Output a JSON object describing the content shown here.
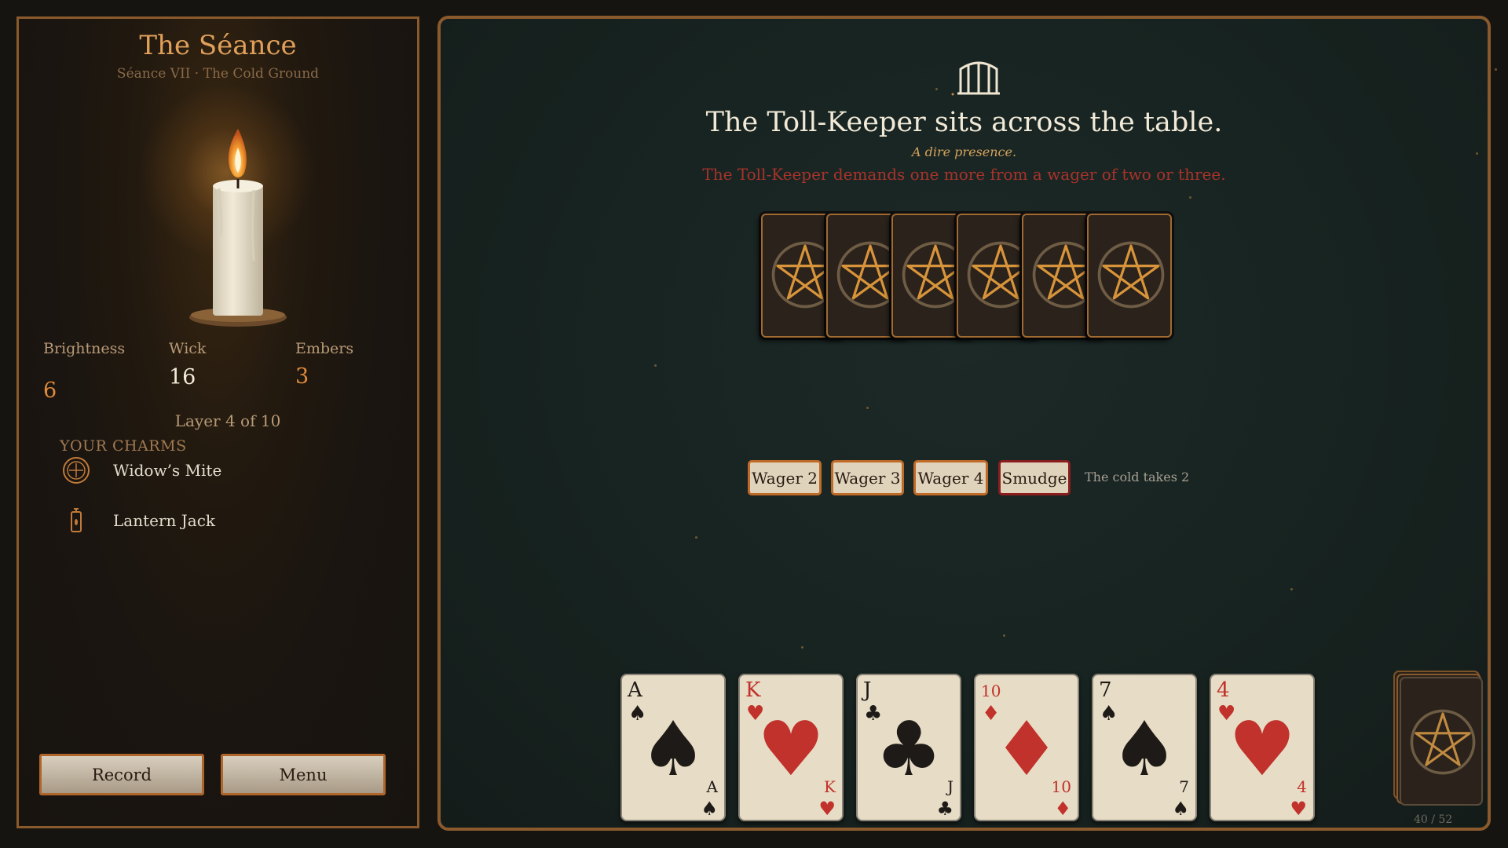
{
  "sidebar": {
    "title": "The Séance",
    "subtitle": "Séance VII · The Cold Ground",
    "stats": [
      {
        "label": "Brightness",
        "value": "6",
        "color": "#e08a3a"
      },
      {
        "label": "Wick",
        "value": "16",
        "color": "#f2ead8"
      },
      {
        "label": "Embers",
        "value": "3",
        "color": "#e08a3a"
      }
    ],
    "layer_text": "Layer 4 of 10",
    "charms_heading": "YOUR CHARMS",
    "charms": [
      {
        "label": "Widow’s Mite",
        "icon": "coin-icon"
      },
      {
        "label": "Lantern Jack",
        "icon": "lantern-icon"
      }
    ],
    "buttons": {
      "record": "Record",
      "menu": "Menu"
    }
  },
  "encounter": {
    "icon": "gate-icon",
    "title": "The Toll-Keeper sits across the table.",
    "subtitle": "A dire presence.",
    "demand": "The Toll-Keeper demands one more from a wager of two or three.",
    "hidden_cards": 6
  },
  "actions": {
    "buttons": [
      "Wager 2",
      "Wager 3",
      "Wager 4",
      "Smudge"
    ],
    "note": "The cold takes 2"
  },
  "hand": [
    {
      "rank": "A",
      "suit": "♠",
      "color": "black"
    },
    {
      "rank": "K",
      "suit": "♥",
      "color": "red"
    },
    {
      "rank": "J",
      "suit": "♣",
      "color": "black"
    },
    {
      "rank": "10",
      "suit": "♦",
      "color": "red"
    },
    {
      "rank": "7",
      "suit": "♠",
      "color": "black"
    },
    {
      "rank": "4",
      "suit": "♥",
      "color": "red"
    }
  ],
  "deck": {
    "count": "40 / 52"
  },
  "colors": {
    "accent": "#c06a28",
    "border": "#8a5a2c",
    "red": "#c0322b"
  }
}
